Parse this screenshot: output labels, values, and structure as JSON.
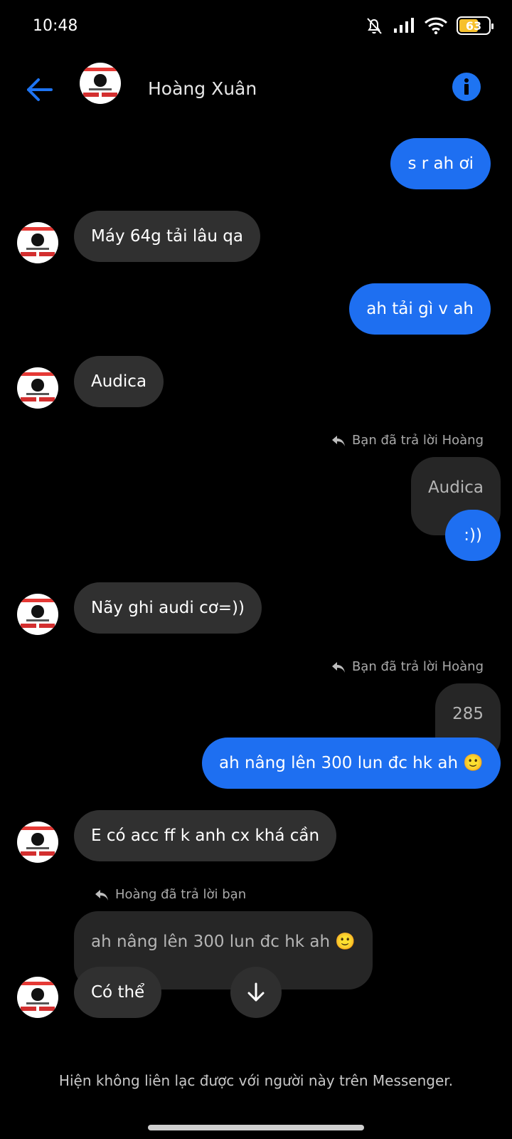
{
  "status_bar": {
    "time": "10:48",
    "battery_level": "63",
    "icons": [
      "bell-muted-icon",
      "signal-icon",
      "wifi-icon",
      "battery-icon"
    ]
  },
  "header": {
    "contact_name": "Hoàng Xuân",
    "back_icon": "arrow-left-icon",
    "info_icon": "info-icon",
    "accent_color": "#1e74f2"
  },
  "messages": {
    "m1": "s r ah ơi",
    "m2": "Máy 64g tải lâu qa",
    "m3": "ah tải gì v ah",
    "m4": "Audica",
    "m5_reply_label": "Bạn đã trả lời Hoàng",
    "m5_quoted": "Audica",
    "m5_text": ":))",
    "m6": "Nãy ghi audi cơ=))",
    "m7_reply_label": "Bạn đã trả lời Hoàng",
    "m7_quoted": "285",
    "m7_text": "ah nâng lên 300 lun đc hk ah 🙂",
    "m8": "E có acc ff k anh cx khá cần",
    "m9_reply_label": "Hoàng đã trả lời bạn",
    "m9_quoted": "ah nâng lên 300 lun đc hk ah 🙂",
    "m9_text": "Có thể"
  },
  "footer": {
    "notice": "Hiện không liên lạc được với người này trên Messenger."
  },
  "colors": {
    "outgoing_bubble": "#1e6ff1",
    "incoming_bubble": "#303030",
    "background": "#000000"
  }
}
